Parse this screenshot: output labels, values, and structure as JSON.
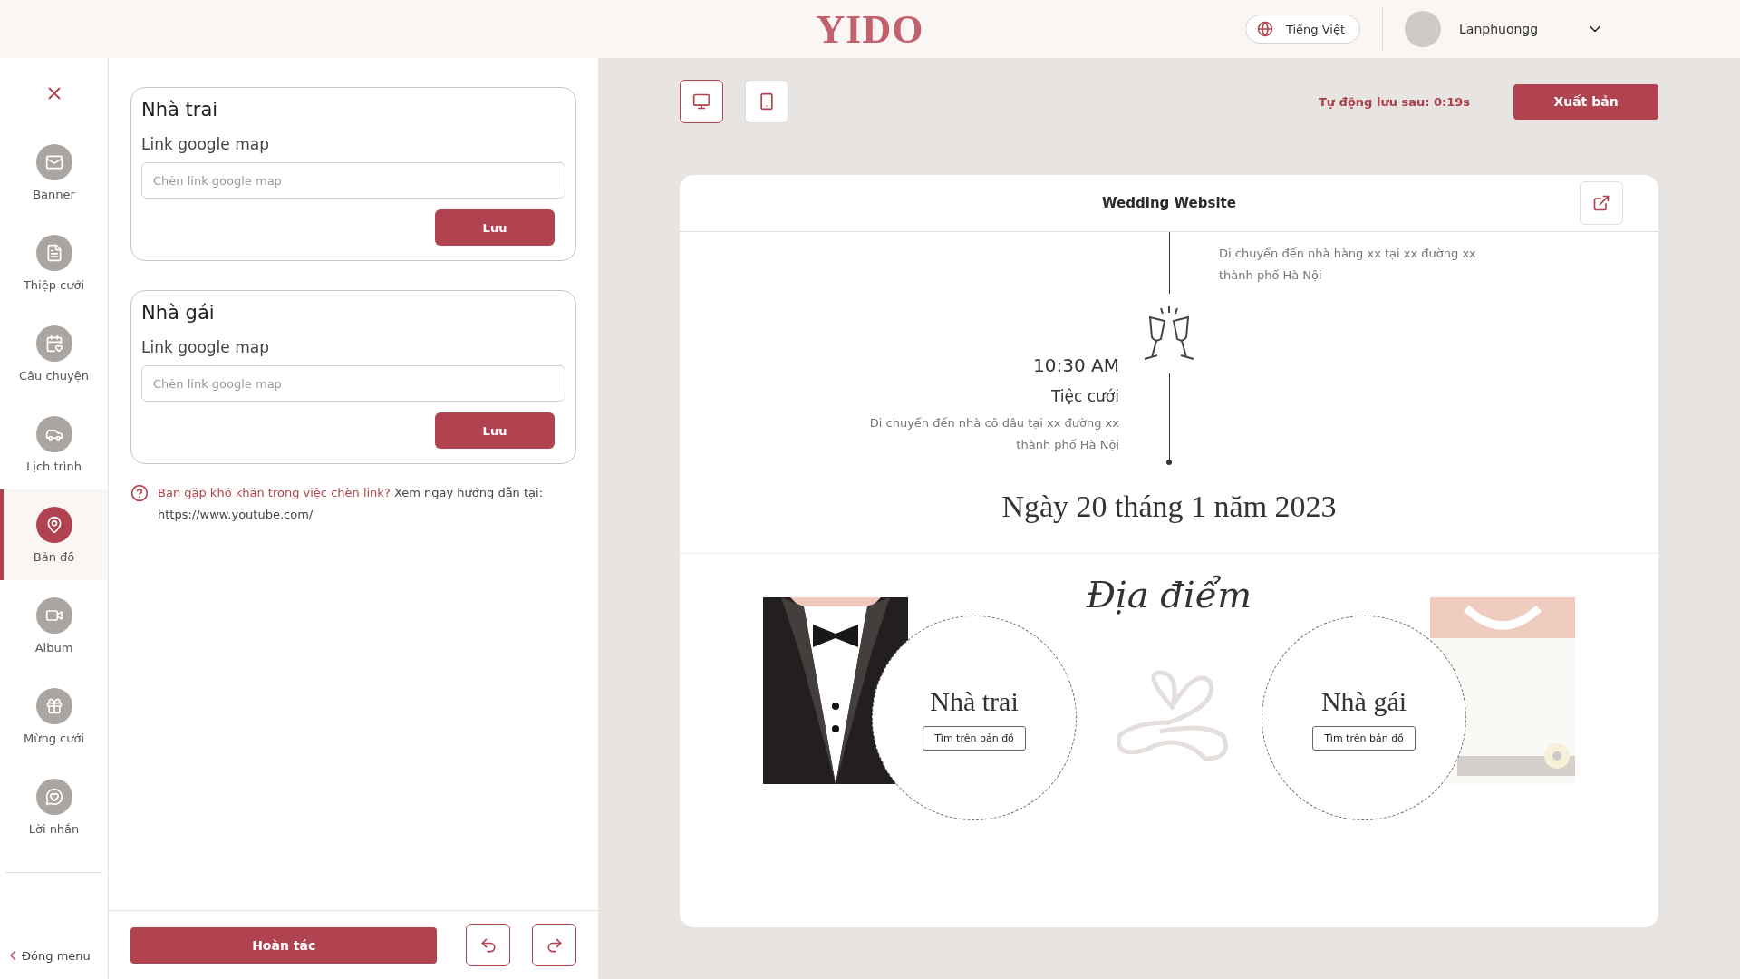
{
  "header": {
    "logo": "YIDO",
    "language": "Tiếng Việt",
    "user_name": "Lanphuongg"
  },
  "sidebar": {
    "items": [
      {
        "label": "Banner",
        "selected": false
      },
      {
        "label": "Thiệp cưới",
        "selected": false
      },
      {
        "label": "Câu chuyện",
        "selected": false
      },
      {
        "label": "Lịch trình",
        "selected": false
      },
      {
        "label": "Bản đồ",
        "selected": true
      },
      {
        "label": "Album",
        "selected": false
      },
      {
        "label": "Mừng cưới",
        "selected": false
      },
      {
        "label": "Lời nhắn",
        "selected": false
      }
    ],
    "close_menu": "Đóng menu"
  },
  "editor": {
    "cards": [
      {
        "title": "Nhà trai",
        "field_label": "Link google map",
        "placeholder": "Chèn link google map",
        "button": "Lưu"
      },
      {
        "title": "Nhà gái",
        "field_label": "Link google map",
        "placeholder": "Chèn link google map",
        "button": "Lưu"
      }
    ],
    "help": {
      "link": "Bạn gặp khó khăn trong việc chèn link?",
      "text": "Xem ngay hướng dẫn tại:",
      "url": "https://www.youtube.com/"
    },
    "undo_all": "Hoàn tác"
  },
  "toolbar": {
    "devices": [
      {
        "kind": "desktop",
        "selected": true
      },
      {
        "kind": "mobile",
        "selected": false
      }
    ],
    "autosave": "Tự động lưu sau: 0:19s",
    "publish": "Xuất bản"
  },
  "preview": {
    "title": "Wedding Website",
    "timeline_note": "Di chuyển đến nhà hàng xx tại xx đường xx thành phố Hà Nội",
    "event": {
      "time": "10:30 AM",
      "title": "Tiệc cưới",
      "description": "Di chuyển đến nhà cô dâu tại xx đường xx thành phố Hà Nội"
    },
    "date": "Ngày 20 tháng 1 năm 2023",
    "section_title": "Địa điểm",
    "locations": [
      {
        "kind": "groom",
        "name": "Nhà trai",
        "button": "Tìm trên bản đồ"
      },
      {
        "kind": "bride",
        "name": "Nhà gái",
        "button": "Tìm trên bản đồ"
      }
    ]
  }
}
